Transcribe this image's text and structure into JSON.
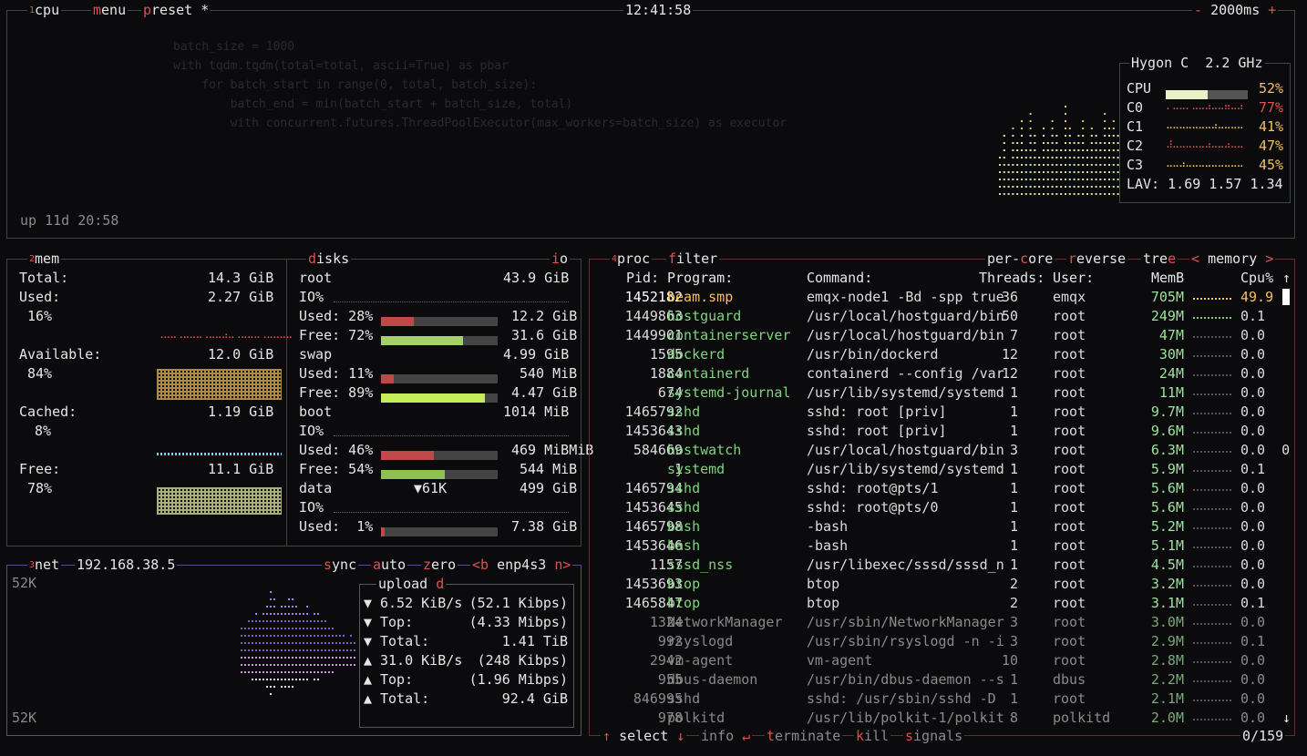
{
  "header": {
    "cpu_label": "cpu",
    "cpu_idx": "1",
    "menu": "menu",
    "preset": "preset *",
    "clock": "12:41:58",
    "interval": "- 2000ms +"
  },
  "cpu": {
    "model": "Hygon C",
    "freq": "2.2 GHz",
    "total_label": "CPU",
    "total_pct": "52%",
    "cores": [
      {
        "name": "C0",
        "pct": "77%"
      },
      {
        "name": "C1",
        "pct": "41%"
      },
      {
        "name": "C2",
        "pct": "47%"
      },
      {
        "name": "C3",
        "pct": "45%"
      }
    ],
    "lav": "LAV: 1.69 1.57 1.34",
    "uptime": "up 11d 20:58"
  },
  "mem": {
    "title_idx": "2",
    "title": "mem",
    "total_label": "Total:",
    "total": "14.3 GiB",
    "used_label": "Used:",
    "used": "2.27 GiB",
    "used_pct": "16%",
    "avail_label": "Available:",
    "avail": "12.0 GiB",
    "avail_pct": "84%",
    "cached_label": "Cached:",
    "cached": "1.19 GiB",
    "cached_pct": "8%",
    "free_label": "Free:",
    "free": "11.1 GiB",
    "free_pct": "78%"
  },
  "disks": {
    "title": "disks",
    "io_tab": "io",
    "root_name": "root",
    "root_size": "43.9 GiB",
    "io1": "IO%",
    "root_used": "Used: 28%",
    "root_used_val": "12.2 GiB",
    "root_free": "Free: 72%",
    "root_free_val": "31.6 GiB",
    "swap_name": "swap",
    "swap_size": "4.99 GiB",
    "swap_used": "Used: 11%",
    "swap_used_val": "540 MiB",
    "swap_free": "Free: 89%",
    "swap_free_val": "4.47 GiB",
    "boot_name": "boot",
    "boot_size": "1014 MiB",
    "io2": "IO%",
    "boot_used": "Used: 46%",
    "boot_used_val": "469 MiBMiB",
    "boot_free": "Free: 54%",
    "boot_free_val": "544 MiB",
    "data_name": "data",
    "data_io": "▼61K",
    "data_size": "499 GiB",
    "io3": "IO%",
    "data_used": "Used:  1%",
    "data_used_val": "7.38 GiB"
  },
  "net": {
    "title_idx": "3",
    "title": "net",
    "ip": "192.168.38.5",
    "sync": "sync",
    "auto": "auto",
    "zero": "zero",
    "iface": "<b enp4s3 n>",
    "scale_top": "52K",
    "scale_bottom": "52K",
    "upload_title": "upload",
    "rows": [
      {
        "arrow": "▼",
        "label": "6.52 KiB/s",
        "value": "(52.1 Kibps)"
      },
      {
        "arrow": "▼",
        "label": "Top:",
        "value": "(4.33 Mibps)"
      },
      {
        "arrow": "▼",
        "label": "Total:",
        "value": "1.41 TiB"
      },
      {
        "arrow": "▲",
        "label": "31.0 KiB/s",
        "value": "(248 Kibps)"
      },
      {
        "arrow": "▲",
        "label": "Top:",
        "value": "(1.96 Mibps)"
      },
      {
        "arrow": "▲",
        "label": "Total:",
        "value": "92.4 GiB"
      }
    ]
  },
  "proc": {
    "title_idx": "4",
    "title": "proc",
    "filter": "filter",
    "per_core": "per-core",
    "reverse": "reverse",
    "tree": "tree",
    "sort": "< memory >",
    "headers": {
      "pid": "Pid:",
      "program": "Program:",
      "command": "Command:",
      "threads": "Threads:",
      "user": "User:",
      "mem": "MemB",
      "cpu": "Cpu%"
    },
    "rows": [
      {
        "pid": "1452182",
        "program": "beam.smp",
        "command": "emqx-node1 -Bd -spp true",
        "threads": "36",
        "user": "emqx",
        "mem": "705M",
        "cpu": "49.9"
      },
      {
        "pid": "1449863",
        "program": "hostguard",
        "command": "/usr/local/hostguard/bin",
        "threads": "50",
        "user": "root",
        "mem": "249M",
        "cpu": "0.1"
      },
      {
        "pid": "1449901",
        "program": "containerserver",
        "command": "/usr/local/hostguard/bin",
        "threads": "7",
        "user": "root",
        "mem": "47M",
        "cpu": "0.0"
      },
      {
        "pid": "1595",
        "program": "dockerd",
        "command": "/usr/bin/dockerd",
        "threads": "12",
        "user": "root",
        "mem": "30M",
        "cpu": "0.0"
      },
      {
        "pid": "1884",
        "program": "containerd",
        "command": "containerd --config /var",
        "threads": "12",
        "user": "root",
        "mem": "24M",
        "cpu": "0.0"
      },
      {
        "pid": "674",
        "program": "systemd-journal",
        "command": "/usr/lib/systemd/systemd",
        "threads": "1",
        "user": "root",
        "mem": "11M",
        "cpu": "0.0"
      },
      {
        "pid": "1465792",
        "program": "sshd",
        "command": "sshd: root [priv]",
        "threads": "1",
        "user": "root",
        "mem": "9.7M",
        "cpu": "0.0"
      },
      {
        "pid": "1453643",
        "program": "sshd",
        "command": "sshd: root [priv]",
        "threads": "1",
        "user": "root",
        "mem": "9.6M",
        "cpu": "0.0"
      },
      {
        "pid": "584669",
        "program": "hostwatch",
        "command": "/usr/local/hostguard/bin",
        "threads": "3",
        "user": "root",
        "mem": "6.3M",
        "cpu": "0.0  0"
      },
      {
        "pid": "1",
        "program": "systemd",
        "command": "/usr/lib/systemd/systemd",
        "threads": "1",
        "user": "root",
        "mem": "5.9M",
        "cpu": "0.1"
      },
      {
        "pid": "1465794",
        "program": "sshd",
        "command": "sshd: root@pts/1",
        "threads": "1",
        "user": "root",
        "mem": "5.6M",
        "cpu": "0.0"
      },
      {
        "pid": "1453645",
        "program": "sshd",
        "command": "sshd: root@pts/0",
        "threads": "1",
        "user": "root",
        "mem": "5.6M",
        "cpu": "0.0"
      },
      {
        "pid": "1465798",
        "program": "bash",
        "command": "-bash",
        "threads": "1",
        "user": "root",
        "mem": "5.2M",
        "cpu": "0.0"
      },
      {
        "pid": "1453646",
        "program": "bash",
        "command": "-bash",
        "threads": "1",
        "user": "root",
        "mem": "5.1M",
        "cpu": "0.0"
      },
      {
        "pid": "1157",
        "program": "sssd_nss",
        "command": "/usr/libexec/sssd/sssd_n",
        "threads": "1",
        "user": "root",
        "mem": "4.5M",
        "cpu": "0.0"
      },
      {
        "pid": "1453693",
        "program": "btop",
        "command": "btop",
        "threads": "2",
        "user": "root",
        "mem": "3.2M",
        "cpu": "0.0"
      },
      {
        "pid": "1465847",
        "program": "btop",
        "command": "btop",
        "threads": "2",
        "user": "root",
        "mem": "3.1M",
        "cpu": "0.1"
      },
      {
        "pid": "1324",
        "program": "NetworkManager",
        "command": "/usr/sbin/NetworkManager",
        "threads": "3",
        "user": "root",
        "mem": "3.0M",
        "cpu": "0.0"
      },
      {
        "pid": "992",
        "program": "rsyslogd",
        "command": "/usr/sbin/rsyslogd -n -i",
        "threads": "3",
        "user": "root",
        "mem": "2.9M",
        "cpu": "0.1"
      },
      {
        "pid": "2942",
        "program": "vm-agent",
        "command": "vm-agent",
        "threads": "10",
        "user": "root",
        "mem": "2.8M",
        "cpu": "0.0"
      },
      {
        "pid": "955",
        "program": "dbus-daemon",
        "command": "/usr/bin/dbus-daemon --s",
        "threads": "1",
        "user": "dbus",
        "mem": "2.2M",
        "cpu": "0.0"
      },
      {
        "pid": "846995",
        "program": "sshd",
        "command": "sshd: /usr/sbin/sshd -D",
        "threads": "1",
        "user": "root",
        "mem": "2.1M",
        "cpu": "0.0"
      },
      {
        "pid": "978",
        "program": "polkitd",
        "command": "/usr/lib/polkit-1/polkit",
        "threads": "8",
        "user": "polkitd",
        "mem": "2.0M",
        "cpu": "0.0"
      }
    ],
    "footer": {
      "select": "↑ select ↓",
      "info": "info ↵",
      "terminate": "terminate",
      "kill": "kill",
      "signals": "signals",
      "count": "0/159"
    }
  },
  "colors": {
    "accent_red": "#e05050",
    "green": "#7ed37e",
    "yellow": "#f3c05a",
    "purple": "#8a5fd0"
  }
}
